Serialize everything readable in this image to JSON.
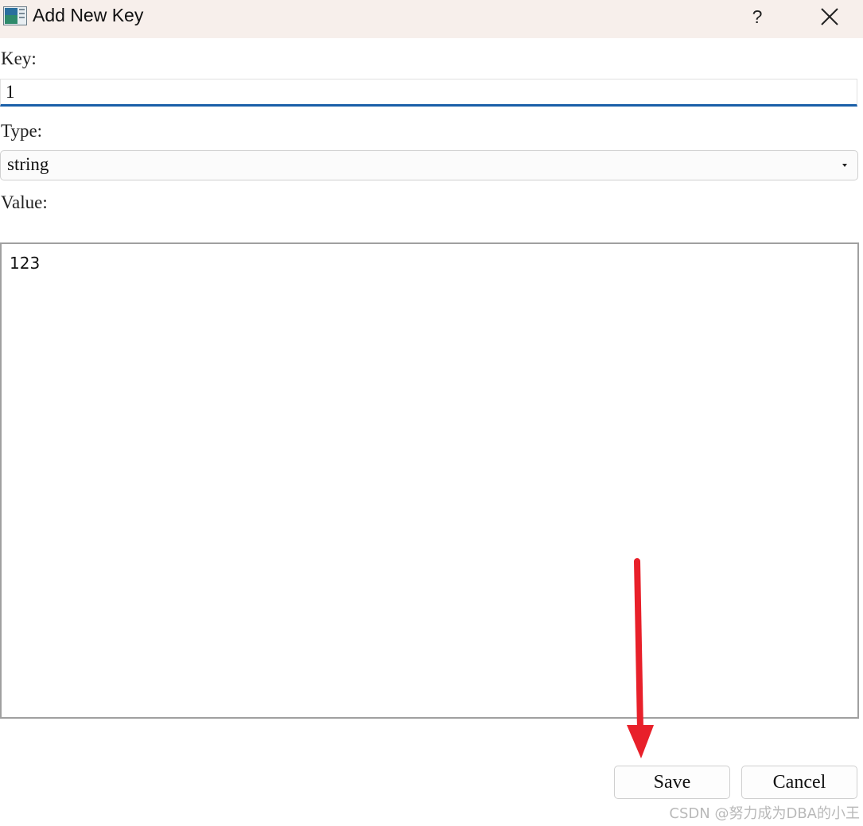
{
  "window": {
    "title": "Add New Key",
    "help_label": "?",
    "icons": {
      "app": "app-icon",
      "close": "close-icon"
    }
  },
  "form": {
    "key_label": "Key:",
    "key_value": "1",
    "type_label": "Type:",
    "type_selected": "string",
    "value_label": "Value:",
    "value_text": "123"
  },
  "buttons": {
    "save_label": "Save",
    "cancel_label": "Cancel"
  },
  "annotation": {
    "arrow_color": "#e8202a",
    "arrow_target": "save-button"
  },
  "watermark": "CSDN @努力成为DBA的小王",
  "colors": {
    "titlebar_bg": "#f7efeb",
    "focus_underline": "#1a5fa8"
  }
}
